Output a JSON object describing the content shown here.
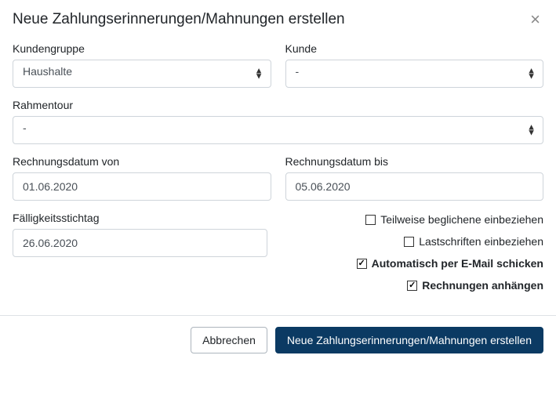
{
  "modal": {
    "title": "Neue Zahlungserinnerungen/Mahnungen erstellen",
    "close_glyph": "×"
  },
  "form": {
    "kundengruppe": {
      "label": "Kundengruppe",
      "value": "Haushalte"
    },
    "kunde": {
      "label": "Kunde",
      "value": "-"
    },
    "rahmentour": {
      "label": "Rahmentour",
      "value": "-"
    },
    "rechnungsdatum_von": {
      "label": "Rechnungsdatum von",
      "value": "01.06.2020"
    },
    "rechnungsdatum_bis": {
      "label": "Rechnungsdatum bis",
      "value": "05.06.2020"
    },
    "faelligkeitsstichtag": {
      "label": "Fälligkeitsstichtag",
      "value": "26.06.2020"
    }
  },
  "checkboxes": {
    "teilweise": {
      "label": "Teilweise beglichene einbeziehen",
      "checked": false
    },
    "lastschriften": {
      "label": "Lastschriften einbeziehen",
      "checked": false
    },
    "email": {
      "label": "Automatisch per E-Mail schicken",
      "checked": true
    },
    "rechnungen": {
      "label": "Rechnungen anhängen",
      "checked": true
    }
  },
  "footer": {
    "cancel": "Abbrechen",
    "submit": "Neue Zahlungserinnerungen/Mahnungen erstellen"
  }
}
